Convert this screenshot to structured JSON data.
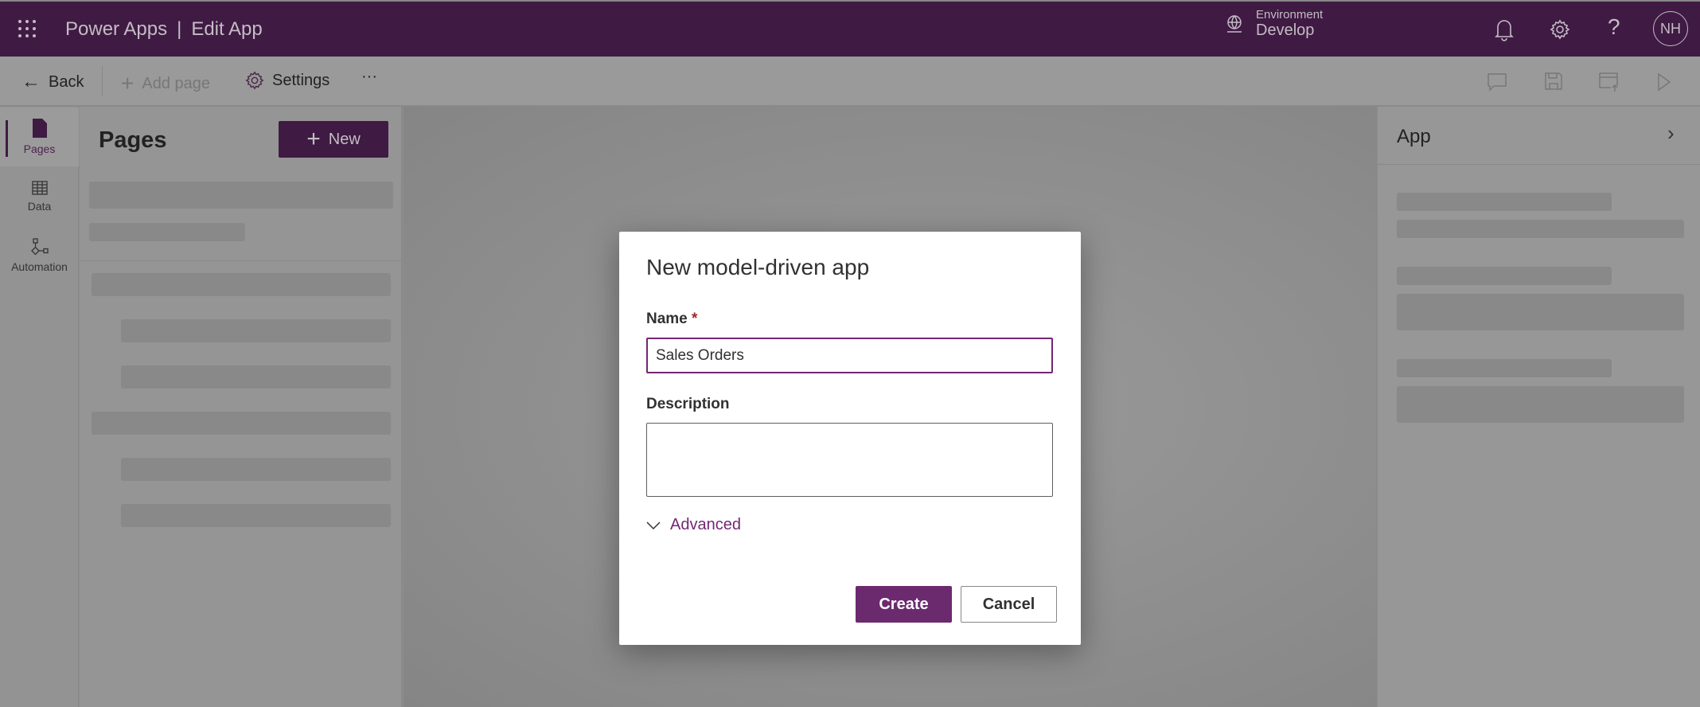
{
  "header": {
    "app_name": "Power Apps",
    "separator": "|",
    "page_title": "Edit App",
    "environment_label": "Environment",
    "environment_name": "Develop",
    "avatar_initials": "NH"
  },
  "toolbar": {
    "back": "Back",
    "add_page": "Add page",
    "settings": "Settings",
    "more": "···"
  },
  "rail": {
    "items": [
      {
        "label": "Pages"
      },
      {
        "label": "Data"
      },
      {
        "label": "Automation"
      }
    ]
  },
  "pages_panel": {
    "title": "Pages",
    "new_button": "New"
  },
  "right_panel": {
    "title": "App"
  },
  "dialog": {
    "title": "New model-driven app",
    "name_label": "Name",
    "required_mark": "*",
    "name_value": "Sales Orders",
    "description_label": "Description",
    "description_value": "",
    "advanced": "Advanced",
    "create": "Create",
    "cancel": "Cancel"
  },
  "colors": {
    "brand": "#742774",
    "create_button": "#6b2a6e",
    "required": "#a4262c"
  }
}
